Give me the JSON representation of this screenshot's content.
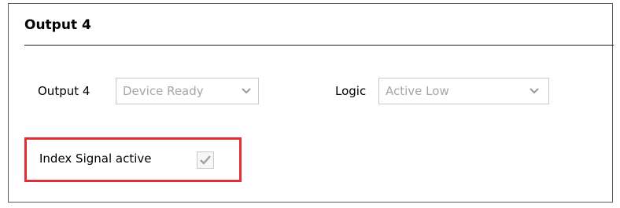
{
  "panel": {
    "title": "Output 4"
  },
  "output_field": {
    "label": "Output 4",
    "selected": "Device Ready"
  },
  "logic_field": {
    "label": "Logic",
    "selected": "Active Low"
  },
  "index_signal": {
    "label": "Index Signal active",
    "checked": true
  },
  "colors": {
    "highlight_border": "#e22f36",
    "disabled_text": "#a6a6a6",
    "control_border": "#c8c8c8"
  },
  "icons": {
    "dropdown": "chevron-down-icon",
    "check": "checkmark-icon"
  }
}
